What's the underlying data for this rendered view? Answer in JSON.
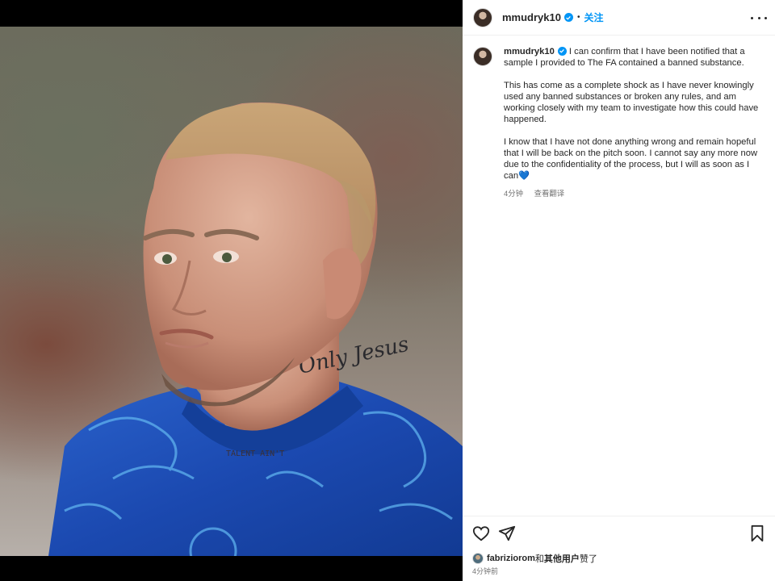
{
  "header": {
    "username": "mmudryk10",
    "separator": "•",
    "follow_label": "关注",
    "avatar_icon": "profile-avatar",
    "verified_icon": "verified-badge-icon",
    "more_icon": "more-options-icon"
  },
  "caption": {
    "username": "mmudryk10",
    "paragraphs": [
      "I can confirm that I have been notified that a sample I provided to The FA contained a banned substance.",
      "This has come as a complete shock as I have never knowingly used any banned substances or broken any rules, and am working closely with my team to investigate how this could have happened.",
      "I know that I have not done anything wrong and remain hopeful that I will be back on the pitch soon. I cannot say any more now due to the confidentiality of the process, but I will as soon as I can💙"
    ],
    "time": "4分钟",
    "translate_label": "查看翻译"
  },
  "media": {
    "tattoo_neck": "Only Jesus",
    "tattoo_chest": "TALENT AIN'T"
  },
  "actions": {
    "like_icon": "heart-icon",
    "share_icon": "share-icon",
    "save_icon": "bookmark-icon"
  },
  "likes": {
    "user": "fabriziorom",
    "connector": "和",
    "others": "其他用户",
    "suffix": "赞了"
  },
  "post_time": "4分钟前",
  "colors": {
    "accent": "#0095f6",
    "text": "#262626",
    "secondary": "#737373",
    "jersey": "#1c4fb5"
  }
}
